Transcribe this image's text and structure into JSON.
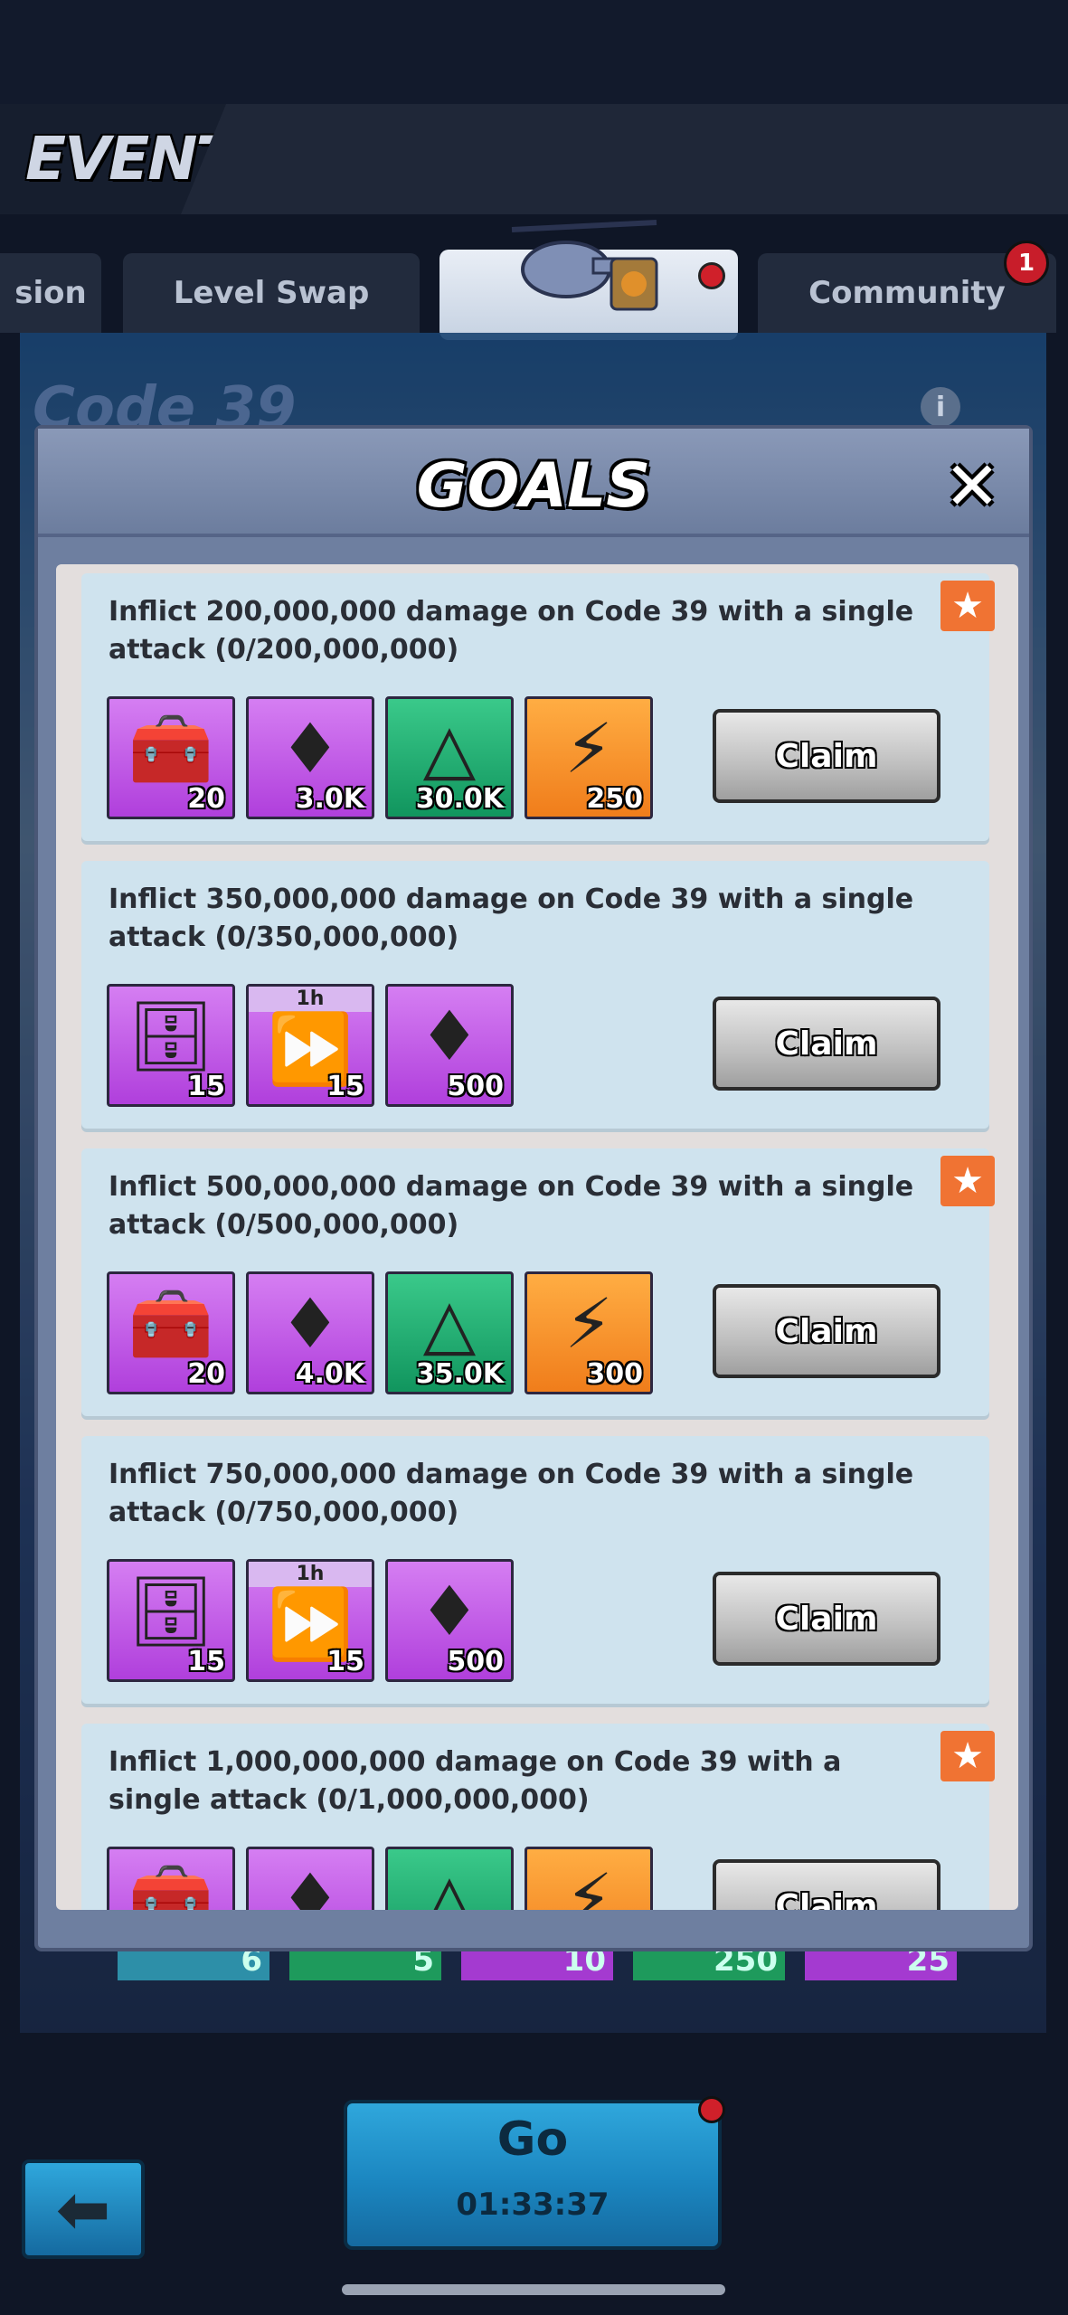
{
  "header": {
    "title": "EVENTS"
  },
  "tabs": [
    {
      "label": "sion"
    },
    {
      "label": "Level Swap"
    },
    {
      "label": ""
    },
    {
      "label": "Community",
      "badge": "1"
    }
  ],
  "event": {
    "title": "Code 39",
    "info_icon": "info-icon"
  },
  "behind_rewards": [
    "6",
    "5",
    "10",
    "250",
    "25"
  ],
  "modal": {
    "title": "GOALS",
    "close_icon": "close-icon",
    "goals": [
      {
        "text": "Inflict 200,000,000 damage on Code 39 with a single attack (0/200,000,000)",
        "starred": true,
        "rewards": [
          {
            "icon": "gold-chest-icon",
            "qty": "20",
            "bg": "purple"
          },
          {
            "icon": "ruby-gem-icon",
            "qty": "3.0K",
            "bg": "purple"
          },
          {
            "icon": "blue-crystal-icon",
            "qty": "30.0K",
            "bg": "green"
          },
          {
            "icon": "skill-scroll-icon",
            "qty": "250",
            "bg": "orange"
          }
        ],
        "claim_label": "Claim"
      },
      {
        "text": "Inflict 350,000,000 damage on Code 39 with a single attack (0/350,000,000)",
        "starred": false,
        "rewards": [
          {
            "icon": "armor-chest-icon",
            "qty": "15",
            "bg": "purple"
          },
          {
            "icon": "speedup-icon",
            "qty": "15",
            "bg": "purple",
            "time": "1h"
          },
          {
            "icon": "ruby-gem-icon",
            "qty": "500",
            "bg": "purple"
          }
        ],
        "claim_label": "Claim"
      },
      {
        "text": "Inflict 500,000,000 damage on Code 39 with a single attack (0/500,000,000)",
        "starred": true,
        "rewards": [
          {
            "icon": "gold-chest-icon",
            "qty": "20",
            "bg": "purple"
          },
          {
            "icon": "ruby-gem-icon",
            "qty": "4.0K",
            "bg": "purple"
          },
          {
            "icon": "blue-crystal-icon",
            "qty": "35.0K",
            "bg": "green"
          },
          {
            "icon": "skill-scroll-icon",
            "qty": "300",
            "bg": "orange"
          }
        ],
        "claim_label": "Claim"
      },
      {
        "text": "Inflict 750,000,000 damage on Code 39 with a single attack (0/750,000,000)",
        "starred": false,
        "rewards": [
          {
            "icon": "armor-chest-icon",
            "qty": "15",
            "bg": "purple"
          },
          {
            "icon": "speedup-icon",
            "qty": "15",
            "bg": "purple",
            "time": "1h"
          },
          {
            "icon": "ruby-gem-icon",
            "qty": "500",
            "bg": "purple"
          }
        ],
        "claim_label": "Claim"
      },
      {
        "text": "Inflict 1,000,000,000 damage on Code 39 with a single attack (0/1,000,000,000)",
        "starred": true,
        "rewards": [
          {
            "icon": "gold-chest-icon",
            "qty": "",
            "bg": "purple"
          },
          {
            "icon": "ruby-gem-icon",
            "qty": "",
            "bg": "purple"
          },
          {
            "icon": "blue-crystal-icon",
            "qty": "",
            "bg": "green"
          },
          {
            "icon": "skill-scroll-icon",
            "qty": "",
            "bg": "orange"
          }
        ],
        "claim_label": "Claim"
      }
    ]
  },
  "go_button": {
    "label": "Go",
    "timer": "01:33:37"
  },
  "back_icon": "back-arrow-icon"
}
